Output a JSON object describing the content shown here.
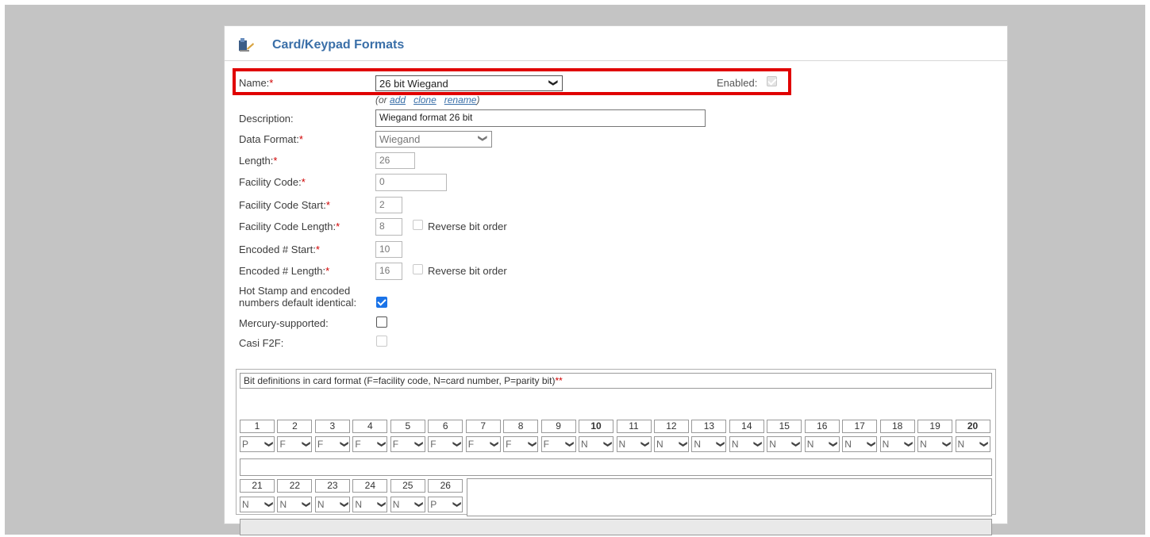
{
  "page": {
    "title": "Card/Keypad Formats"
  },
  "form": {
    "name_label": "Name:",
    "name_value": "26 bit Wiegand",
    "enabled_label": "Enabled:",
    "sub_links": {
      "prefix": "(or",
      "add": "add",
      "clone": "clone",
      "rename": "rename",
      "suffix": ")"
    },
    "description_label": "Description:",
    "description_value": "Wiegand format 26 bit",
    "data_format_label": "Data Format:",
    "data_format_value": "Wiegand",
    "length_label": "Length:",
    "length_value": "26",
    "facility_code_label": "Facility Code:",
    "facility_code_value": "0",
    "facility_start_label": "Facility Code Start:",
    "facility_start_value": "2",
    "facility_length_label": "Facility Code Length:",
    "facility_length_value": "8",
    "reverse_label": "Reverse bit order",
    "encoded_start_label": "Encoded # Start:",
    "encoded_start_value": "10",
    "encoded_length_label": "Encoded # Length:",
    "encoded_length_value": "16",
    "hot_stamp_label_line1": "Hot Stamp and encoded",
    "hot_stamp_label_line2": "numbers default identical:",
    "mercury_label": "Mercury-supported:",
    "casi_label": "Casi F2F:",
    "required_mark": "*"
  },
  "bits": {
    "caption": "Bit definitions in card format (F=facility code, N=card number, P=parity bit)",
    "caption_mark": "**",
    "row1": [
      {
        "n": "1",
        "v": "P"
      },
      {
        "n": "2",
        "v": "F"
      },
      {
        "n": "3",
        "v": "F"
      },
      {
        "n": "4",
        "v": "F"
      },
      {
        "n": "5",
        "v": "F"
      },
      {
        "n": "6",
        "v": "F"
      },
      {
        "n": "7",
        "v": "F"
      },
      {
        "n": "8",
        "v": "F"
      },
      {
        "n": "9",
        "v": "F"
      },
      {
        "n": "10",
        "v": "N"
      },
      {
        "n": "11",
        "v": "N"
      },
      {
        "n": "12",
        "v": "N"
      },
      {
        "n": "13",
        "v": "N"
      },
      {
        "n": "14",
        "v": "N"
      },
      {
        "n": "15",
        "v": "N"
      },
      {
        "n": "16",
        "v": "N"
      },
      {
        "n": "17",
        "v": "N"
      },
      {
        "n": "18",
        "v": "N"
      },
      {
        "n": "19",
        "v": "N"
      },
      {
        "n": "20",
        "v": "N"
      }
    ],
    "row2": [
      {
        "n": "21",
        "v": "N"
      },
      {
        "n": "22",
        "v": "N"
      },
      {
        "n": "23",
        "v": "N"
      },
      {
        "n": "24",
        "v": "N"
      },
      {
        "n": "25",
        "v": "N"
      },
      {
        "n": "26",
        "v": "P"
      }
    ],
    "bold_numbers": [
      "10",
      "20"
    ]
  }
}
